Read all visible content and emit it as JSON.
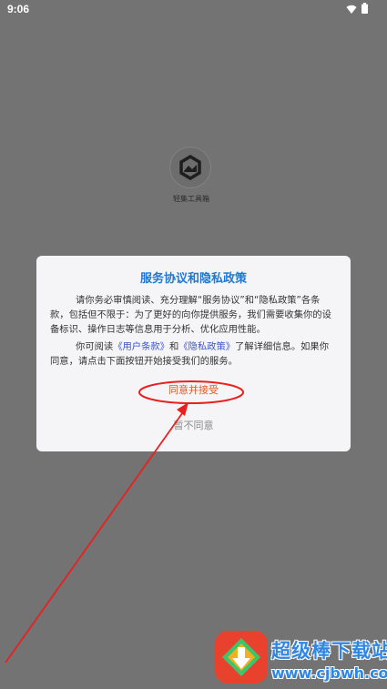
{
  "status_bar": {
    "time": "9:06",
    "wifi_icon": "wifi-icon",
    "battery_icon": "battery-icon"
  },
  "app": {
    "logo_icon": "app-logo-icon",
    "name": "轻集工具箱"
  },
  "dialog": {
    "title": "服务协议和隐私政策",
    "paragraph1": "请你务必审慎阅读、充分理解“服务协议”和“隐私政策”各条款，包括但不限于：为了更好的向你提供服务，我们需要收集你的设备标识、操作日志等信息用于分析、优化应用性能。",
    "paragraph2_prefix": "你可阅读",
    "user_terms_link": "《用户条款》",
    "paragraph2_and": "和",
    "privacy_link": "《隐私政策》",
    "paragraph2_suffix": "了解详细信息。如果你同意，请点击下面按钮开始接受我们的服务。",
    "agree_label": "同意并接受",
    "disagree_label": "暂不同意"
  },
  "colors": {
    "background": "#737373",
    "dialog_bg": "#f5f5f8",
    "title": "#1e78d6",
    "link": "#3c54c9",
    "agree": "#e05a22",
    "disagree": "#8a8a8a",
    "annotation": "#e8201e"
  },
  "watermark": {
    "logo_icon": "download-site-logo-icon",
    "name": "超级棒下载站",
    "url": "www.cjbwh.com"
  }
}
